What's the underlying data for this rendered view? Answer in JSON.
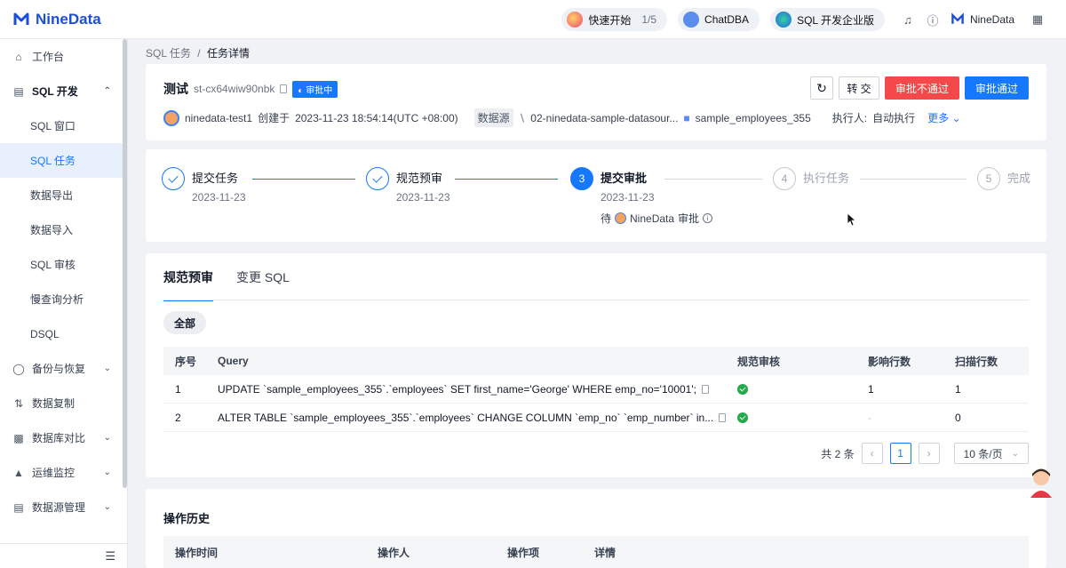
{
  "app": {
    "brand": "NineData"
  },
  "topbar": {
    "quickstart": {
      "label": "快速开始",
      "progress": "1/5"
    },
    "chatdba": {
      "label": "ChatDBA"
    },
    "edition": {
      "label": "SQL 开发企业版"
    },
    "user": {
      "name": "NineData"
    }
  },
  "sidebar": {
    "items": [
      {
        "label": "工作台",
        "icon": "home-icon"
      },
      {
        "label": "SQL 开发",
        "icon": "sql-dev-icon"
      },
      {
        "label": "SQL 窗口"
      },
      {
        "label": "SQL 任务"
      },
      {
        "label": "数据导出"
      },
      {
        "label": "数据导入"
      },
      {
        "label": "SQL 审核"
      },
      {
        "label": "慢查询分析"
      },
      {
        "label": "DSQL"
      },
      {
        "label": "备份与恢复",
        "icon": "backup-icon"
      },
      {
        "label": "数据复制",
        "icon": "replication-icon"
      },
      {
        "label": "数据库对比",
        "icon": "compare-icon"
      },
      {
        "label": "运维监控",
        "icon": "monitor-icon"
      },
      {
        "label": "数据源管理",
        "icon": "datasource-icon"
      }
    ]
  },
  "breadcrumb": {
    "parent": "SQL 任务",
    "sep": "/",
    "current": "任务详情"
  },
  "task": {
    "name": "测试",
    "id": "st-cx64wiw90nbk",
    "status": "审批中",
    "creator": "ninedata-test1",
    "created_label": "创建于",
    "created_at": "2023-11-23 18:54:14(UTC +08:00)",
    "datasource_label": "数据源",
    "datasource": "02-ninedata-sample-datasour...",
    "database": "sample_employees_355",
    "executor_label": "执行人:",
    "executor": "自动执行",
    "more": "更多"
  },
  "actions": {
    "transfer": "转 交",
    "reject": "审批不通过",
    "approve": "审批通过"
  },
  "steps": [
    {
      "num": "1",
      "title": "提交任务",
      "date": "2023-11-23",
      "state": "done"
    },
    {
      "num": "2",
      "title": "规范预审",
      "date": "2023-11-23",
      "state": "done"
    },
    {
      "num": "3",
      "title": "提交审批",
      "date": "2023-11-23",
      "state": "active",
      "pending_prefix": "待",
      "pending_user": "NineData",
      "pending_suffix": "审批"
    },
    {
      "num": "4",
      "title": "执行任务",
      "date": "",
      "state": "wait"
    },
    {
      "num": "5",
      "title": "完成",
      "date": "",
      "state": "wait"
    }
  ],
  "review": {
    "tabs": [
      "规范预审",
      "变更 SQL"
    ],
    "filter": "全部",
    "columns": [
      "序号",
      "Query",
      "规范审核",
      "影响行数",
      "扫描行数"
    ],
    "rows": [
      {
        "no": "1",
        "query": "UPDATE `sample_employees_355`.`employees` SET first_name='George' WHERE emp_no='10001';",
        "affected": "1",
        "scanned": "1"
      },
      {
        "no": "2",
        "query": "ALTER TABLE `sample_employees_355`.`employees` CHANGE COLUMN `emp_no` `emp_number` in...",
        "affected": "-",
        "scanned": "0"
      }
    ],
    "pagination": {
      "total": "共 2 条",
      "current": "1",
      "page_size": "10 条/页"
    }
  },
  "history": {
    "title": "操作历史",
    "columns": [
      "操作时间",
      "操作人",
      "操作项",
      "详情"
    ]
  }
}
